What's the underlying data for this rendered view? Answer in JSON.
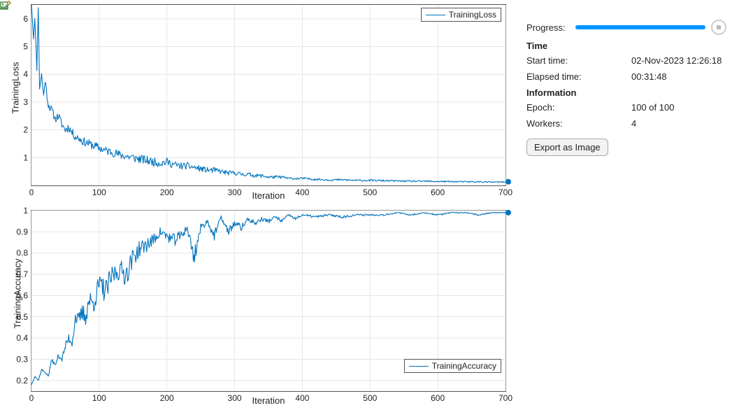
{
  "chart_data": [
    {
      "type": "line",
      "title": "",
      "xlabel": "Iteration",
      "ylabel": "TrainingLoss",
      "xlim": [
        0,
        700
      ],
      "ylim": [
        0,
        6.5
      ],
      "xticks": [
        0,
        100,
        200,
        300,
        400,
        500,
        600,
        700
      ],
      "yticks": [
        1,
        2,
        3,
        4,
        5,
        6
      ],
      "legend": "TrainingLoss",
      "legend_pos": "top-right",
      "series": [
        {
          "name": "TrainingLoss",
          "x_sample": [
            0,
            3,
            5,
            8,
            10,
            12,
            15,
            18,
            20,
            25,
            30,
            35,
            40,
            45,
            50,
            55,
            60,
            65,
            70,
            75,
            80,
            85,
            90,
            95,
            100,
            110,
            120,
            130,
            140,
            150,
            160,
            170,
            180,
            190,
            200,
            210,
            220,
            230,
            240,
            250,
            260,
            270,
            280,
            290,
            300,
            310,
            320,
            330,
            340,
            350,
            360,
            370,
            380,
            390,
            400,
            420,
            440,
            460,
            480,
            500,
            520,
            540,
            560,
            580,
            600,
            620,
            640,
            660,
            680,
            700
          ],
          "y_sample": [
            6.5,
            5.3,
            6.0,
            4.2,
            6.4,
            3.5,
            4.0,
            3.2,
            3.8,
            2.9,
            2.7,
            2.4,
            2.5,
            2.2,
            2.0,
            2.1,
            1.9,
            1.75,
            1.7,
            1.6,
            1.55,
            1.5,
            1.45,
            1.4,
            1.35,
            1.25,
            1.2,
            1.1,
            1.05,
            1.0,
            0.95,
            0.9,
            0.85,
            0.8,
            0.85,
            0.75,
            0.7,
            0.7,
            0.65,
            0.6,
            0.55,
            0.55,
            0.5,
            0.45,
            0.45,
            0.4,
            0.4,
            0.35,
            0.35,
            0.3,
            0.3,
            0.3,
            0.25,
            0.25,
            0.25,
            0.22,
            0.2,
            0.2,
            0.18,
            0.18,
            0.17,
            0.16,
            0.15,
            0.15,
            0.14,
            0.14,
            0.13,
            0.13,
            0.12,
            0.12
          ]
        }
      ]
    },
    {
      "type": "line",
      "title": "",
      "xlabel": "Iteration",
      "ylabel": "TrainingAccuracy",
      "xlim": [
        0,
        700
      ],
      "ylim": [
        0.15,
        1.0
      ],
      "xticks": [
        0,
        100,
        200,
        300,
        400,
        500,
        600,
        700
      ],
      "yticks": [
        0.2,
        0.3,
        0.4,
        0.5,
        0.6,
        0.7,
        0.8,
        0.9,
        1.0
      ],
      "legend": "TrainingAccuracy",
      "legend_pos": "bottom-right",
      "series": [
        {
          "name": "TrainingAccuracy",
          "x_sample": [
            0,
            5,
            10,
            15,
            20,
            25,
            30,
            35,
            40,
            45,
            50,
            55,
            60,
            65,
            70,
            75,
            80,
            85,
            90,
            95,
            100,
            110,
            120,
            130,
            140,
            150,
            160,
            170,
            180,
            190,
            200,
            210,
            220,
            230,
            240,
            250,
            260,
            270,
            280,
            290,
            300,
            310,
            320,
            330,
            340,
            350,
            360,
            370,
            380,
            390,
            400,
            420,
            440,
            460,
            480,
            500,
            520,
            540,
            560,
            580,
            600,
            620,
            640,
            660,
            680,
            700
          ],
          "y_sample": [
            0.18,
            0.22,
            0.2,
            0.25,
            0.24,
            0.22,
            0.3,
            0.27,
            0.32,
            0.3,
            0.36,
            0.4,
            0.38,
            0.5,
            0.48,
            0.52,
            0.5,
            0.58,
            0.56,
            0.6,
            0.65,
            0.62,
            0.7,
            0.72,
            0.7,
            0.78,
            0.82,
            0.84,
            0.86,
            0.9,
            0.88,
            0.86,
            0.88,
            0.92,
            0.78,
            0.92,
            0.95,
            0.88,
            0.97,
            0.9,
            0.94,
            0.92,
            0.96,
            0.94,
            0.96,
            0.95,
            0.97,
            0.95,
            0.98,
            0.96,
            0.98,
            0.97,
            0.98,
            0.97,
            0.98,
            0.98,
            0.98,
            0.99,
            0.98,
            0.99,
            0.98,
            0.99,
            0.99,
            0.98,
            0.99,
            0.99
          ]
        }
      ]
    }
  ],
  "side": {
    "progress_label": "Progress:",
    "progress_pct": 100,
    "time_header": "Time",
    "start_label": "Start time:",
    "start_value": "02-Nov-2023 12:26:18",
    "elapsed_label": "Elapsed time:",
    "elapsed_value": "00:31:48",
    "info_header": "Information",
    "epoch_label": "Epoch:",
    "epoch_value": "100 of 100",
    "workers_label": "Workers:",
    "workers_value": "4",
    "export_label": "Export as Image"
  },
  "colors": {
    "series": "#0072bd"
  }
}
